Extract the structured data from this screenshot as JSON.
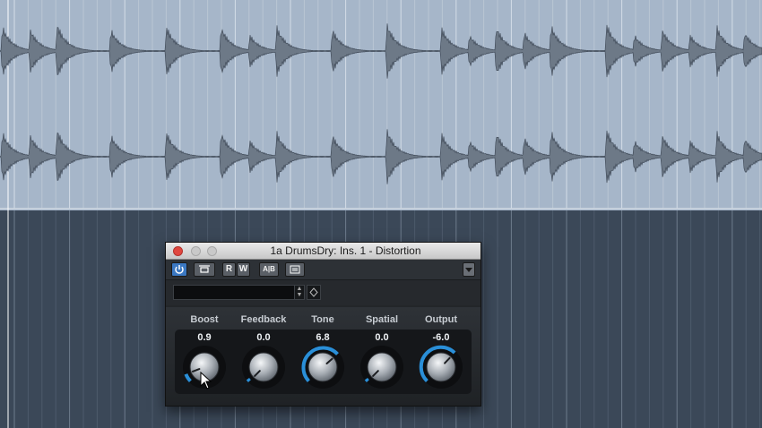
{
  "window": {
    "title": "1a DrumsDry: Ins. 1 - Distortion"
  },
  "toolbar": {
    "buttons": [
      {
        "id": "power",
        "label": "",
        "icon": "power-icon"
      },
      {
        "id": "bypass",
        "label": "",
        "icon": "bypass-icon"
      },
      {
        "id": "read",
        "label": "R"
      },
      {
        "id": "write",
        "label": "W"
      },
      {
        "id": "compare",
        "label": "A|B"
      },
      {
        "id": "settings",
        "label": "",
        "icon": "settings-icon"
      }
    ],
    "menu_icon": "triangle-down-icon"
  },
  "preset": {
    "value": ""
  },
  "params": [
    {
      "id": "boost",
      "label": "Boost",
      "value": "0.9",
      "level": 0.09
    },
    {
      "id": "feedback",
      "label": "Feedback",
      "value": "0.0",
      "level": 0.0
    },
    {
      "id": "tone",
      "label": "Tone",
      "value": "6.8",
      "level": 0.68
    },
    {
      "id": "spatial",
      "label": "Spatial",
      "value": "0.0",
      "level": 0.0
    },
    {
      "id": "output",
      "label": "Output",
      "value": "-6.0",
      "level": 0.66
    }
  ],
  "colors": {
    "accent": "#2a8fd8",
    "arrange_top": "#a3b3c6",
    "arrange_bottom": "#3b4858"
  }
}
